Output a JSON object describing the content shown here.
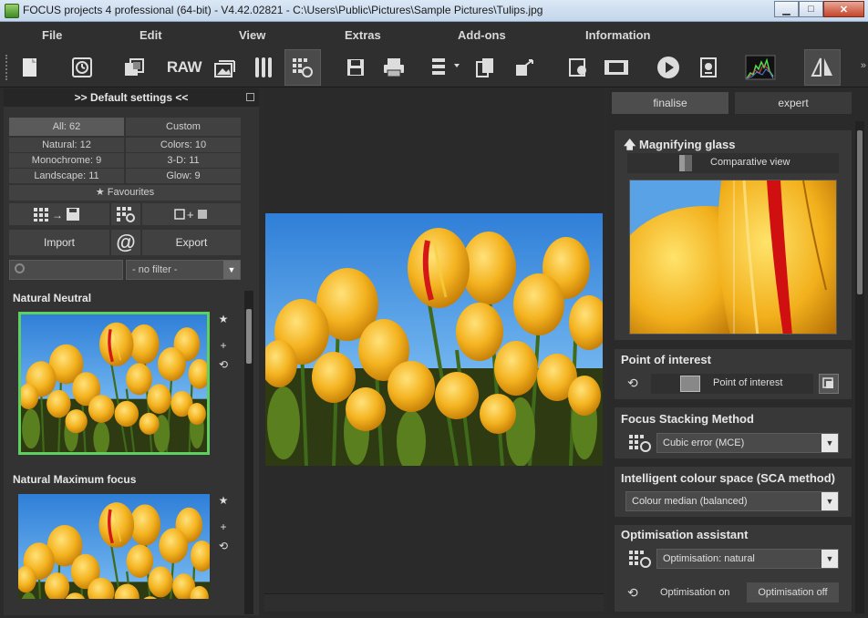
{
  "window": {
    "title": "FOCUS projects 4 professional (64-bit) - V4.42.02821 - C:\\Users\\Public\\Pictures\\Sample Pictures\\Tulips.jpg"
  },
  "menu": [
    "File",
    "Edit",
    "View",
    "Extras",
    "Add-ons",
    "Information"
  ],
  "toolbar": {
    "raw_label": "RAW"
  },
  "left_panel": {
    "header": ">> Default settings <<",
    "categories": [
      "All: 62",
      "Custom",
      "Natural: 12",
      "Colors: 10",
      "Monochrome: 9",
      "3-D: 11",
      "Landscape: 11",
      "Glow: 9"
    ],
    "favourites": "Favourites",
    "import_label": "Import",
    "export_label": "Export",
    "at_symbol": "@",
    "filter_value": "- no filter -",
    "presets": [
      {
        "title": "Natural Neutral"
      },
      {
        "title": "Natural Maximum focus"
      }
    ]
  },
  "right_panel": {
    "tabs": [
      "finalise",
      "expert"
    ],
    "magnifier": {
      "title": "Magnifying glass",
      "comparative": "Comparative view"
    },
    "poi": {
      "title": "Point of interest",
      "label": "Point of interest"
    },
    "stacking": {
      "title": "Focus Stacking Method",
      "value": "Cubic error (MCE)"
    },
    "colour_space": {
      "title": "Intelligent colour space (SCA method)",
      "value": "Colour median (balanced)"
    },
    "optimisation": {
      "title": "Optimisation assistant",
      "value": "Optimisation: natural",
      "on_label": "Optimisation on",
      "off_label": "Optimisation off"
    }
  },
  "colors": {
    "accent_green": "#5fcf5f",
    "tulip_yellow": "#f2b01c",
    "sky": "#3a8de0"
  }
}
